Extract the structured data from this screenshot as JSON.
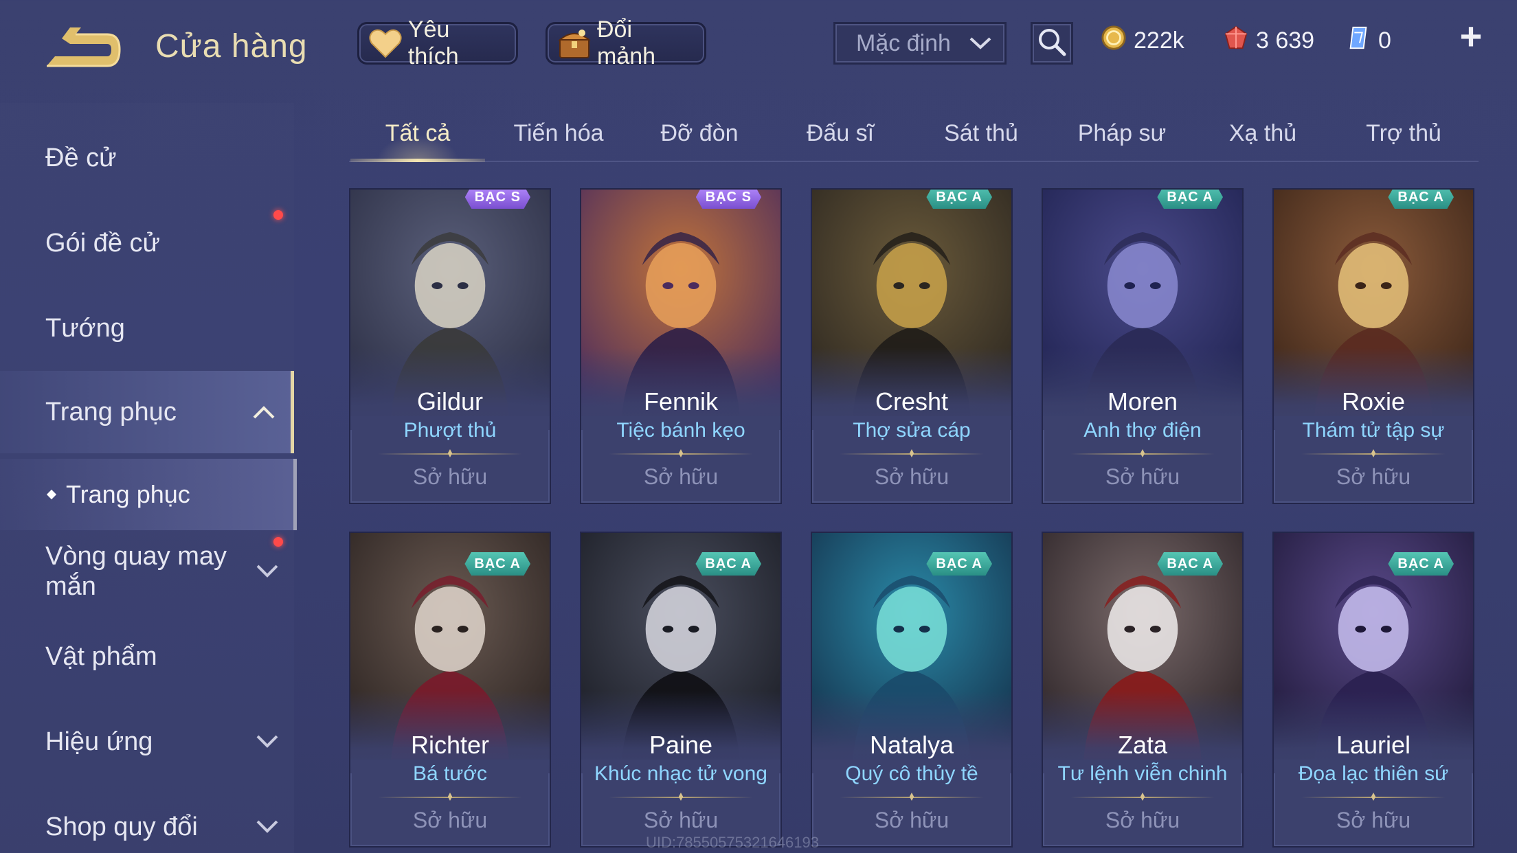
{
  "header": {
    "title": "Cửa hàng",
    "favorites_label": "Yêu thích",
    "fragments_label": "Đổi mảnh",
    "sort_value": "Mặc định",
    "currencies": {
      "gold": "222k",
      "voucher": "3 639",
      "diamond": "0"
    },
    "plus_label": "+"
  },
  "sidebar": {
    "items": [
      {
        "label": "Đề cử"
      },
      {
        "label": "Gói đề cử"
      },
      {
        "label": "Tướng"
      },
      {
        "label": "Trang phục"
      },
      {
        "label": "Vòng quay may mắn"
      },
      {
        "label": "Vật phẩm"
      },
      {
        "label": "Hiệu ứng"
      },
      {
        "label": "Shop quy đổi"
      }
    ],
    "sub_item": "Trang phục"
  },
  "tabs": [
    "Tất cả",
    "Tiến hóa",
    "Đỡ đòn",
    "Đấu sĩ",
    "Sát thủ",
    "Pháp sư",
    "Xạ thủ",
    "Trợ thủ"
  ],
  "cards": [
    {
      "hero": "Gildur",
      "skin": "Phượt thủ",
      "status": "Sở hữu",
      "badge": "BẠC S"
    },
    {
      "hero": "Fennik",
      "skin": "Tiệc bánh kẹo",
      "status": "Sở hữu",
      "badge": "BẠC S"
    },
    {
      "hero": "Cresht",
      "skin": "Thợ sửa cáp",
      "status": "Sở hữu",
      "badge": "BẠC A"
    },
    {
      "hero": "Moren",
      "skin": "Anh thợ điện",
      "status": "Sở hữu",
      "badge": "BẠC A"
    },
    {
      "hero": "Roxie",
      "skin": "Thám tử tập sự",
      "status": "Sở hữu",
      "badge": "BẠC A"
    },
    {
      "hero": "Richter",
      "skin": "Bá tước",
      "status": "Sở hữu",
      "badge": "BẠC A"
    },
    {
      "hero": "Paine",
      "skin": "Khúc nhạc tử vong",
      "status": "Sở hữu",
      "badge": "BẠC A"
    },
    {
      "hero": "Natalya",
      "skin": "Quý cô thủy tề",
      "status": "Sở hữu",
      "badge": "BẠC A"
    },
    {
      "hero": "Zata",
      "skin": "Tư lệnh viễn chinh",
      "status": "Sở hữu",
      "badge": "BẠC A"
    },
    {
      "hero": "Lauriel",
      "skin": "Đọa lạc thiên sứ",
      "status": "Sở hữu",
      "badge": "BẠC A"
    }
  ],
  "watermark": "UID:7855057532164619​3",
  "colors": {
    "accent_gold": "#e9ddb2",
    "skin_name_blue": "#8fd6ff",
    "badge_teal": "#2a8f85",
    "notification_red": "#ff4a4a"
  }
}
